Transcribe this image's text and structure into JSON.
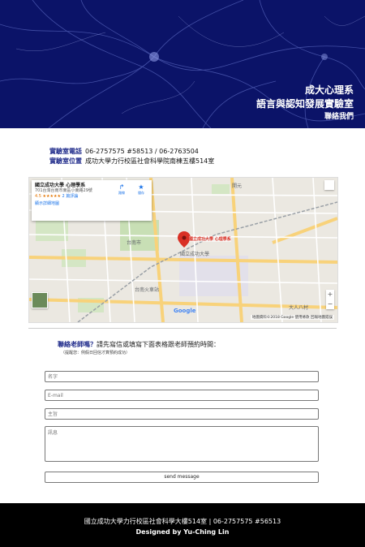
{
  "hero": {
    "title": "成大心理系",
    "subtitle": "語言與認知發展實驗室",
    "contact_link": "聯絡我們"
  },
  "info": {
    "phone_label": "實驗室電話",
    "phone_value": "06-2757575 #58513 / 06-2763504",
    "location_label": "實驗室位置",
    "location_value": "成功大學力行校區社會科學院南棟五樓514室"
  },
  "map": {
    "place_name": "國立成功大學 心理學系",
    "address": "701台灣台南市東區小東路29號",
    "rating": "4.5 ★★★★★",
    "reviews": "2 篇評論",
    "directions_label": "路線",
    "save_label": "儲存",
    "larger_map_label": "顯示詳細地圖",
    "pin_label": "國立成功大學 心理學系",
    "google_logo": "Google",
    "attribution": "地圖資料©2018 Google   使用條款   回報地圖錯誤",
    "labels": [
      "國立成功大學",
      "台南市",
      "開元",
      "大人八村",
      "台南火車站"
    ]
  },
  "contact": {
    "question_highlight": "聯絡老師嗎？",
    "question_rest": "請先寫信或填寫下面表格跟老師預約時間：",
    "note": "（提醒您：例假日回信才算預約成功）",
    "name_placeholder": "名字",
    "email_placeholder": "E-mail",
    "subject_placeholder": "主旨",
    "message_placeholder": "訊息",
    "send_label": "send message"
  },
  "footer": {
    "address_line": "國立成功大學力行校區社會科學大樓514室 | 06-2757575 #56513",
    "designer_line": "Designed by Yu-Ching Lin"
  },
  "colors": {
    "hero_bg": "#0b1368",
    "label_blue": "#1e2a8a",
    "footer_bg": "#000000",
    "pin_red": "#d93025"
  }
}
